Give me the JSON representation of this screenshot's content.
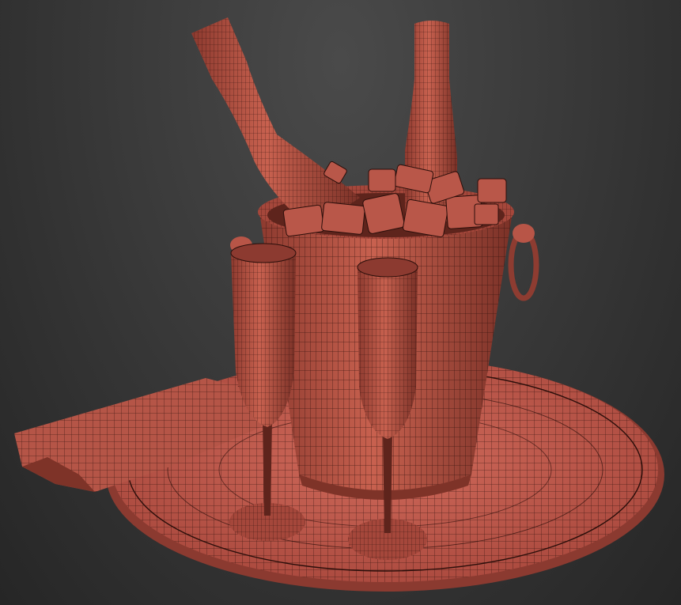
{
  "scene": {
    "objects": [
      "champagne-bottle",
      "champagne-bottle",
      "ice-bucket",
      "ice-cubes",
      "champagne-flute",
      "champagne-flute",
      "folded-napkin",
      "serving-tray"
    ]
  },
  "colors": {
    "background_top": "#4a4a4a",
    "background_bottom": "#262626",
    "mesh_fill": "#b9564a",
    "mesh_fill_light": "#d47466",
    "mesh_fill_dark": "#7e3328",
    "wire": "#2a0e0a"
  }
}
